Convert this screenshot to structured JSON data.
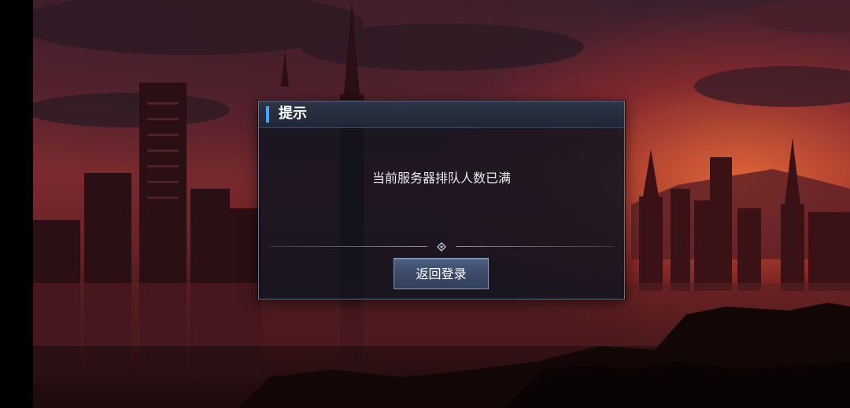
{
  "dialog": {
    "title": "提示",
    "message": "当前服务器排队人数已满",
    "button_label": "返回登录",
    "accent_color": "#4aa3ff"
  },
  "icons": {
    "divider": "diamond-ornament-icon"
  }
}
